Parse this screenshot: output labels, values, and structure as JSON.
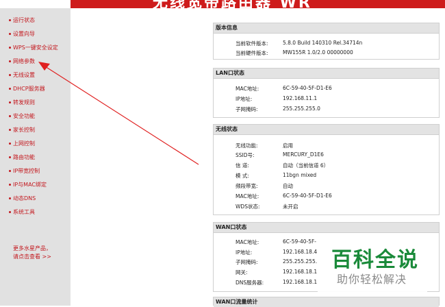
{
  "banner": {
    "title": "无线宽带路由器 WR"
  },
  "sidebar": {
    "items": [
      {
        "label": "运行状态"
      },
      {
        "label": "设置向导"
      },
      {
        "label": "WPS一键安全设定"
      },
      {
        "label": "网络参数"
      },
      {
        "label": "无线设置"
      },
      {
        "label": "DHCP服务器"
      },
      {
        "label": "转发规则"
      },
      {
        "label": "安全功能"
      },
      {
        "label": "家长控制"
      },
      {
        "label": "上网控制"
      },
      {
        "label": "路由功能"
      },
      {
        "label": "IP带宽控制"
      },
      {
        "label": "IP与MAC绑定"
      },
      {
        "label": "动态DNS"
      },
      {
        "label": "系统工具"
      }
    ],
    "more_line1": "更多水星产品，",
    "more_line2": "请点击查看 >>"
  },
  "version": {
    "title": "版本信息",
    "rows": [
      {
        "label": "当前软件版本:",
        "value": "5.8.0 Build 140310 Rel.34714n"
      },
      {
        "label": "当前硬件版本:",
        "value": "MW155R 1.0/2.0 00000000"
      }
    ]
  },
  "lan": {
    "title": "LAN口状态",
    "rows": [
      {
        "label": "MAC地址:",
        "value": "6C-59-40-5F-D1-E6"
      },
      {
        "label": "IP地址:",
        "value": "192.168.11.1"
      },
      {
        "label": "子网掩码:",
        "value": "255.255.255.0"
      }
    ]
  },
  "wireless": {
    "title": "无线状态",
    "rows": [
      {
        "label": "无线功能:",
        "value": "启用"
      },
      {
        "label": "SSID号:",
        "value": "MERCURY_D1E6"
      },
      {
        "label": "信 道:",
        "value": "自动（当前信道 6）"
      },
      {
        "label": "模 式:",
        "value": "11bgn mixed"
      },
      {
        "label": "频段带宽:",
        "value": "自动"
      },
      {
        "label": "MAC地址:",
        "value": "6C-59-40-5F-D1-E6"
      },
      {
        "label": "WDS状态:",
        "value": "未开启"
      }
    ]
  },
  "wan": {
    "title": "WAN口状态",
    "rows": [
      {
        "label": "MAC地址:",
        "value": "6C-59-40-5F-"
      },
      {
        "label": "IP地址:",
        "value": "192.168.18.4"
      },
      {
        "label": "子网掩码:",
        "value": "255.255.255."
      },
      {
        "label": "网关:",
        "value": "192.168.18.1"
      },
      {
        "label": "DNS服务器:",
        "value": "192.168.18.1"
      }
    ]
  },
  "wan_traffic": {
    "title": "WAN口流量统计"
  },
  "watermark": {
    "title": "百科全说",
    "subtitle": "助你轻松解决"
  },
  "colors": {
    "brand_red": "#ce1b1b",
    "link_red": "#c3171d",
    "sidebar_bg": "#e1e1e1"
  }
}
